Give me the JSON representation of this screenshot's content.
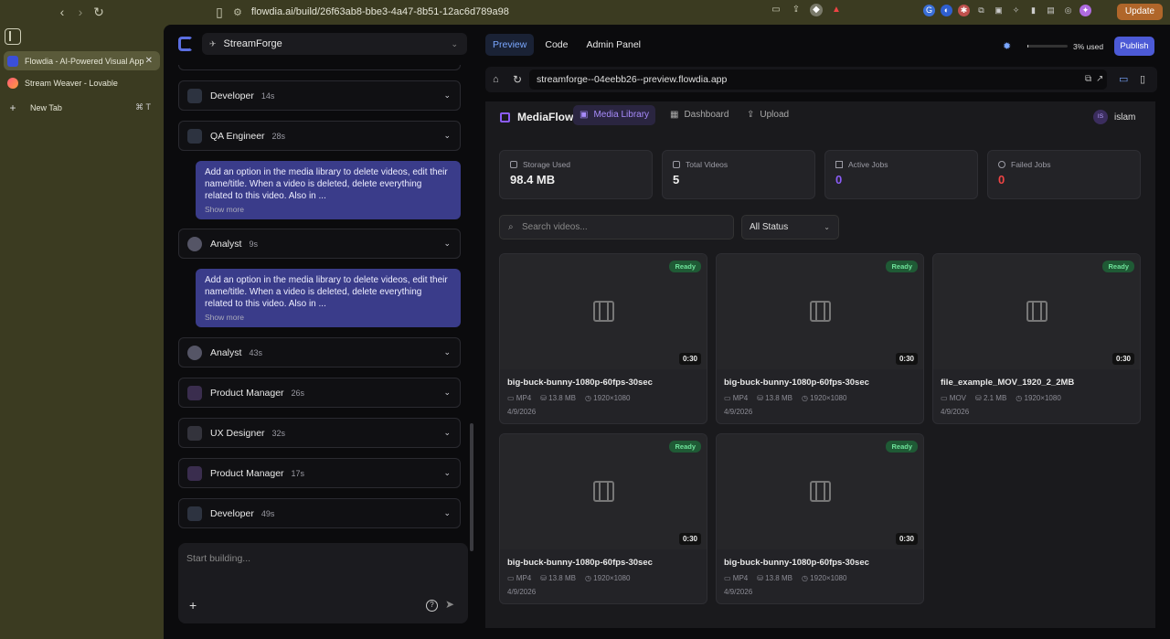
{
  "browser": {
    "url": "flowdia.ai/build/26f63ab8-bbe3-4a47-8b51-12ac6d789a98",
    "update_label": "Update",
    "tabs": [
      {
        "label": "Flowdia - AI-Powered Visual App"
      },
      {
        "label": "Stream Weaver - Lovable"
      },
      {
        "label": "New Tab",
        "shortcut": "⌘ T"
      }
    ]
  },
  "chat": {
    "project": "StreamForge",
    "agents": [
      {
        "name": "Developer",
        "time": "14s"
      },
      {
        "name": "QA Engineer",
        "time": "28s"
      },
      {
        "name": "Analyst",
        "time": "9s"
      },
      {
        "name": "Analyst",
        "time": "43s"
      },
      {
        "name": "Product Manager",
        "time": "26s"
      },
      {
        "name": "UX Designer",
        "time": "32s"
      },
      {
        "name": "Product Manager",
        "time": "17s"
      },
      {
        "name": "Developer",
        "time": "49s"
      }
    ],
    "messages": [
      {
        "text": "Add an option in the media library to delete videos, edit their name/title. When a video is deleted, delete everything related to this video. Also in ...",
        "more": "Show more"
      },
      {
        "text": "Add an option in the media library to delete videos, edit their name/title. When a video is deleted, delete everything related to this video. Also in ...",
        "more": "Show more"
      }
    ],
    "composer_placeholder": "Start building..."
  },
  "preview": {
    "tabs": [
      "Preview",
      "Code",
      "Admin Panel"
    ],
    "usage_label": "3% used",
    "usage_fraction": 0.03,
    "publish_label": "Publish",
    "address": "streamforge--04eebb26--preview.flowdia.app"
  },
  "app": {
    "brand": "MediaFlow",
    "nav": [
      "Media Library",
      "Dashboard",
      "Upload"
    ],
    "user_initials": "IS",
    "user_name": "islam",
    "stats": [
      {
        "label": "Storage Used",
        "value": "98.4 MB",
        "color": "#f0f0f0"
      },
      {
        "label": "Total Videos",
        "value": "5",
        "color": "#f0f0f0"
      },
      {
        "label": "Active Jobs",
        "value": "0",
        "color": "#8b5cf6"
      },
      {
        "label": "Failed Jobs",
        "value": "0",
        "color": "#ef4444"
      }
    ],
    "search_placeholder": "Search videos...",
    "status_filter": "All Status",
    "videos": [
      {
        "title": "big-buck-bunny-1080p-60fps-30sec",
        "format": "MP4",
        "size": "13.8 MB",
        "resolution": "1920×1080",
        "date": "4/9/2026",
        "duration": "0:30",
        "status": "Ready"
      },
      {
        "title": "big-buck-bunny-1080p-60fps-30sec",
        "format": "MP4",
        "size": "13.8 MB",
        "resolution": "1920×1080",
        "date": "4/9/2026",
        "duration": "0:30",
        "status": "Ready"
      },
      {
        "title": "file_example_MOV_1920_2_2MB",
        "format": "MOV",
        "size": "2.1 MB",
        "resolution": "1920×1080",
        "date": "4/9/2026",
        "duration": "0:30",
        "status": "Ready"
      },
      {
        "title": "big-buck-bunny-1080p-60fps-30sec",
        "format": "MP4",
        "size": "13.8 MB",
        "resolution": "1920×1080",
        "date": "4/9/2026",
        "duration": "0:30",
        "status": "Ready"
      },
      {
        "title": "big-buck-bunny-1080p-60fps-30sec",
        "format": "MP4",
        "size": "13.8 MB",
        "resolution": "1920×1080",
        "date": "4/9/2026",
        "duration": "0:30",
        "status": "Ready"
      }
    ]
  }
}
